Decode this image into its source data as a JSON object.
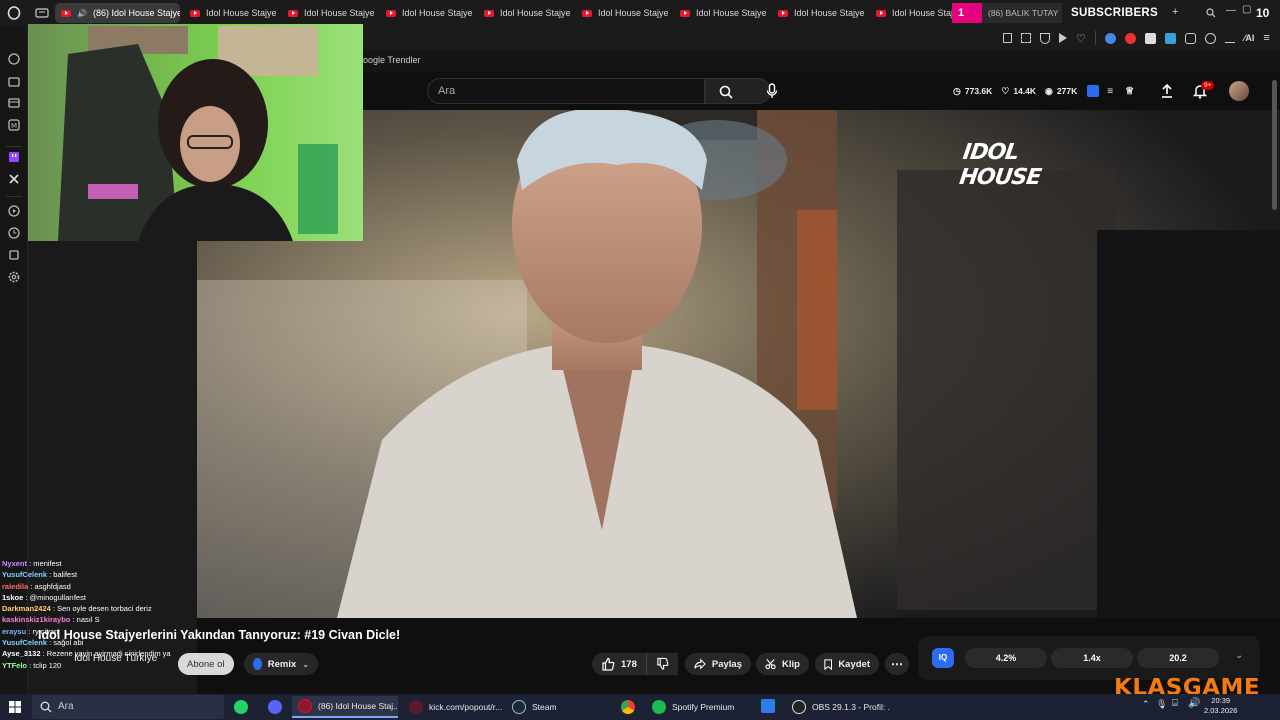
{
  "tabs": [
    {
      "label": "(86) Idol House Stajye",
      "active": true
    },
    {
      "label": "Idol House Stajyer"
    },
    {
      "label": "Idol House Stajye"
    },
    {
      "label": "Idol House Stajye"
    },
    {
      "label": "Idol House Stajye"
    },
    {
      "label": "Idol House Stajye"
    },
    {
      "label": "Idol House Stajye"
    },
    {
      "label": "Idol House Stajye"
    },
    {
      "label": "Idol House Stajye"
    }
  ],
  "subscriber_widget": {
    "count_badge": "1",
    "tab_label": "(86) BALIK TUTAY",
    "title": "SUBSCRIBERS",
    "number": "10"
  },
  "bookmarks": {
    "label": "oogle Trendler"
  },
  "youtube": {
    "search_placeholder": "Ara",
    "stats": {
      "views": "773.6K",
      "likes": "14.4K",
      "viewers": "277K"
    },
    "notification_count": "9+"
  },
  "video": {
    "watermark": "IDOL HOUSE",
    "title": "Idol House Stajyerlerini Yakından Tanıyoruz: #19 Civan Dicle!",
    "channel": "Idol House Türkiye",
    "subscribe_label": "Abone ol",
    "remix_label": "Remix",
    "like_count": "178",
    "share_label": "Paylaş",
    "clip_label": "Klip",
    "save_label": "Kaydet",
    "iq_badge": "IQ",
    "iq_stats": [
      "4.2%",
      "1.4x",
      "20.2"
    ]
  },
  "chat": [
    {
      "user": "Nyxent",
      "msg": "menifest",
      "color": "#c889ff"
    },
    {
      "user": "YusufCelenk",
      "msg": "balifest",
      "color": "#7fd3ff"
    },
    {
      "user": "raledila",
      "msg": "asghfdjasd",
      "color": "#ff6b6b"
    },
    {
      "user": "1skoe",
      "msg": "@minogullarıfest",
      "color": "#ffffff"
    },
    {
      "user": "Darkman2424",
      "msg": "Sen oyle desen torbaci deriz",
      "color": "#ffd36b"
    },
    {
      "user": "kaskinskiz1kiraybo",
      "msg": "nasıl S",
      "color": "#ff7ad9"
    },
    {
      "user": "eraysu",
      "msg": "ry civan",
      "color": "#7fb2ff"
    },
    {
      "user": "YusufCelenk",
      "msg": "sağol abi",
      "color": "#7fd3ff"
    },
    {
      "user": "Ayse_3132",
      "msg": "Rezene yayin ayirmadi sinirlendim ya",
      "color": "#ffffff"
    },
    {
      "user": "YTFelo",
      "msg": "tclip 120",
      "color": "#9cff9c"
    }
  ],
  "taskbar": {
    "search_placeholder": "Ara",
    "items": [
      "(86) Idol House Staj...",
      "kick.com/popout/r...",
      "Steam",
      "Spotify Premium",
      "OBS 29.1.3 - Profil: ..."
    ],
    "time": "20:39",
    "date": "2.03.2026"
  },
  "brand_overlay": "KLASGAME",
  "colors": {
    "accent_red": "#ff0033",
    "iq_blue": "#2c6cf0",
    "klas_orange": "#f47a12",
    "sub_pink": "#e6007e"
  }
}
